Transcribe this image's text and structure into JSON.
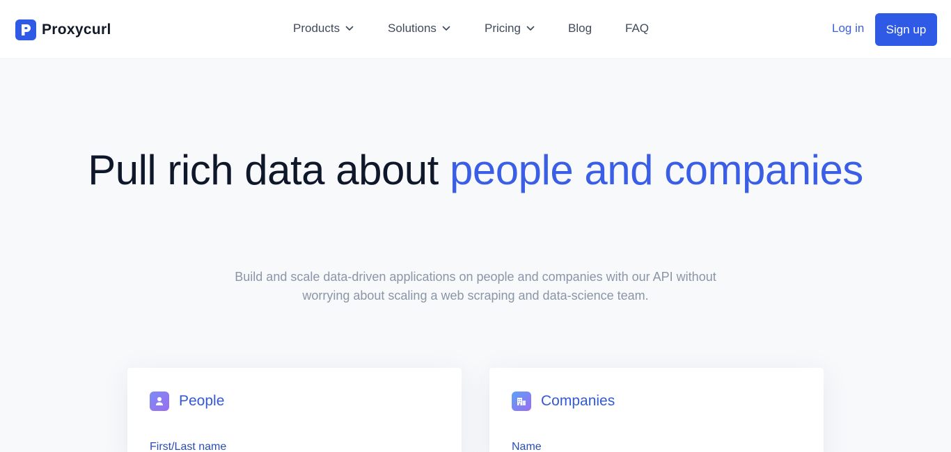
{
  "brand": {
    "name": "Proxycurl",
    "logo_icon": "proxycurl-p-logo-icon",
    "color": "#2f5ae6"
  },
  "nav": {
    "products": "Products",
    "solutions": "Solutions",
    "pricing": "Pricing",
    "blog": "Blog",
    "faq": "FAQ",
    "dropdown_icon": "chevron-down-icon"
  },
  "auth": {
    "login": "Log in",
    "signup": "Sign up"
  },
  "hero": {
    "title_plain": "Pull rich data about ",
    "title_accent": "people and companies",
    "subtitle": "Build and scale data-driven applications on people and companies with our API without worrying about scaling a web scraping and data-science team."
  },
  "cards": {
    "people": {
      "title": "People",
      "icon": "person-icon",
      "field_label": "First/Last name"
    },
    "companies": {
      "title": "Companies",
      "icon": "building-icon",
      "field_label": "Name"
    }
  },
  "colors": {
    "accent": "#3a5fe6",
    "text": "#0f172a",
    "muted": "#8a95a8",
    "background": "#f8f9fb"
  }
}
